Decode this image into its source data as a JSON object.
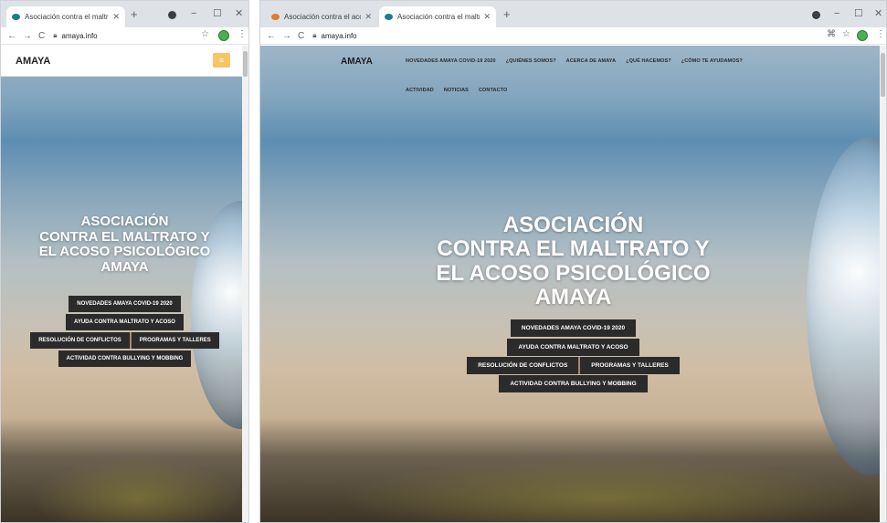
{
  "left_window": {
    "tab": {
      "title": "Asociación contra el maltrato y"
    },
    "new_tab": "+",
    "window_controls": {
      "minimize": "−",
      "maximize": "☐",
      "close": "✕"
    },
    "address_bar": {
      "url": "amaya.info",
      "back": "←",
      "forward": "→",
      "reload": "C",
      "star": "☆"
    },
    "site": {
      "brand": "AMAYA",
      "menu_icon": "≡"
    }
  },
  "right_window": {
    "tabs": [
      {
        "title": "Asociación contra el acoso escol"
      },
      {
        "title": "Asociación contra el maltrato y e"
      }
    ],
    "new_tab": "+",
    "window_controls": {
      "minimize": "−",
      "maximize": "☐",
      "close": "✕"
    },
    "address_bar": {
      "url": "amaya.info",
      "back": "←",
      "forward": "→",
      "reload": "C",
      "translate": "⌘",
      "star": "☆"
    },
    "site": {
      "brand": "AMAYA",
      "menu_row1": [
        "NOVEDADES AMAYA COVID-19 2020",
        "¿QUIÉNES SOMOS?",
        "ACERCA DE AMAYA",
        "¿QUÉ HACEMOS?",
        "¿CÓMO TE AYUDAMOS?"
      ],
      "menu_row2": [
        "ACTIVIDAD",
        "NOTICIAS",
        "CONTACTO"
      ]
    }
  },
  "hero": {
    "title_lines": [
      "ASOCIACIÓN",
      "CONTRA EL MALTRATO Y",
      "EL ACOSO PSICOLÓGICO",
      "AMAYA"
    ],
    "buttons": {
      "covid": "NOVEDADES AMAYA COVID-19 2020",
      "ayuda": "AYUDA CONTRA MALTRATO Y ACOSO",
      "resolucion": "RESOLUCIÓN DE CONFLICTOS",
      "programas": "PROGRAMAS Y TALLERES",
      "actividad": "ACTIVIDAD CONTRA BULLYING Y MOBBING"
    }
  },
  "colors": {
    "tab_strip": "#dee1e6",
    "button_bg": "#2b2b2b",
    "menu_button": "#f6c564",
    "hero_text": "#ffffff"
  }
}
